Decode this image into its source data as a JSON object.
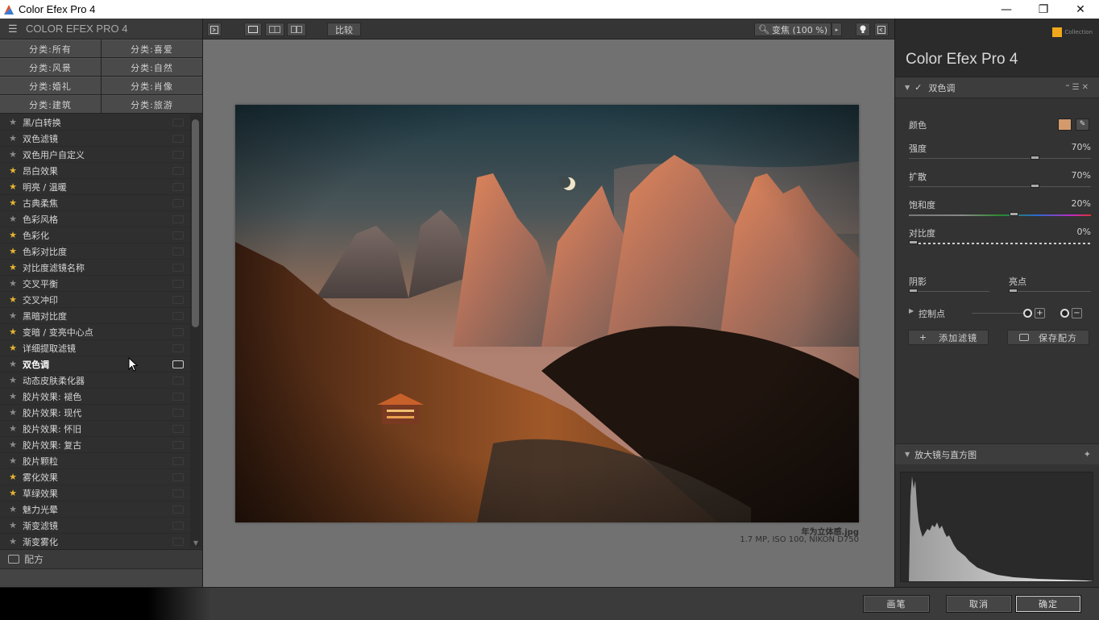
{
  "window": {
    "title": "Color Efex Pro 4",
    "controls": {
      "minimize": "—",
      "maximize": "❐",
      "close": "✕"
    }
  },
  "left_panel": {
    "header": "COLOR EFEX PRO 4",
    "categories": [
      "分类:所有",
      "分类:喜爱",
      "分类:风景",
      "分类:自然",
      "分类:婚礼",
      "分类:肖像",
      "分类:建筑",
      "分类:旅游"
    ],
    "filters": [
      {
        "label": "黑/白转换",
        "fav": false
      },
      {
        "label": "双色滤镜",
        "fav": false
      },
      {
        "label": "双色用户自定义",
        "fav": false
      },
      {
        "label": "昂白效果",
        "fav": true
      },
      {
        "label": "明亮 / 温暖",
        "fav": true
      },
      {
        "label": "古典柔焦",
        "fav": true
      },
      {
        "label": "色彩风格",
        "fav": false
      },
      {
        "label": "色彩化",
        "fav": true
      },
      {
        "label": "色彩对比度",
        "fav": true
      },
      {
        "label": "对比度滤镜名称",
        "fav": true
      },
      {
        "label": "交叉平衡",
        "fav": false
      },
      {
        "label": "交叉冲印",
        "fav": true
      },
      {
        "label": "黑暗对比度",
        "fav": false
      },
      {
        "label": "变暗 / 变亮中心点",
        "fav": true
      },
      {
        "label": "详细提取滤镜",
        "fav": true
      },
      {
        "label": "双色调",
        "fav": false,
        "selected": true
      },
      {
        "label": "动态皮肤柔化器",
        "fav": false
      },
      {
        "label": "胶片效果: 褪色",
        "fav": false
      },
      {
        "label": "胶片效果: 现代",
        "fav": false
      },
      {
        "label": "胶片效果: 怀旧",
        "fav": false
      },
      {
        "label": "胶片效果: 复古",
        "fav": false
      },
      {
        "label": "胶片颗粒",
        "fav": false
      },
      {
        "label": "雾化效果",
        "fav": true
      },
      {
        "label": "草绿效果",
        "fav": true
      },
      {
        "label": "魅力光晕",
        "fav": false
      },
      {
        "label": "渐变滤镜",
        "fav": false
      },
      {
        "label": "渐变雾化",
        "fav": false
      }
    ],
    "recipes_label": "配方"
  },
  "toolbar": {
    "compare_label": "比较",
    "zoom_label": "变焦 (100 %)"
  },
  "canvas": {
    "filename": "年为立体感.jpg",
    "meta": "1.7 MP, ISO 100, NIKON D750"
  },
  "right_panel": {
    "brand_small": "Collection",
    "title": "Color Efex Pro",
    "title_version": "4",
    "filter_name": "双色调",
    "color_label": "颜色",
    "swatch_color": "#d39a6c",
    "controls": [
      {
        "name": "强度",
        "value": "70%",
        "level": 0.7
      },
      {
        "name": "扩散",
        "value": "70%",
        "level": 0.7
      },
      {
        "name": "饱和度",
        "value": "20%",
        "level": 0.58
      },
      {
        "name": "对比度",
        "value": "0%",
        "level": 0.0
      }
    ],
    "shadows_label": "阴影",
    "highlights_label": "亮点",
    "control_points_label": "控制点",
    "add_filter_label": "添加滤镜",
    "save_recipe_label": "保存配方",
    "loupe_label": "放大镜与直方图"
  },
  "bottom": {
    "brush_label": "画笔",
    "cancel_label": "取消",
    "ok_label": "确定"
  }
}
